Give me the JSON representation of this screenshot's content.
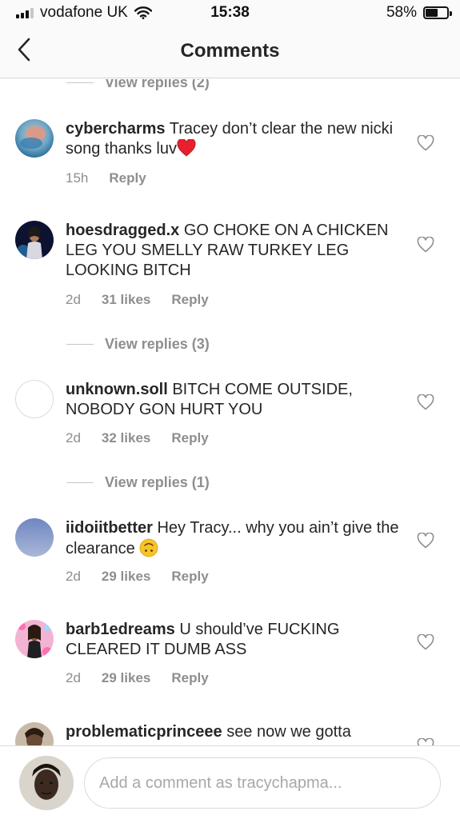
{
  "status_bar": {
    "carrier": "vodafone UK",
    "time": "15:38",
    "battery": "58%",
    "battery_level": 0.58
  },
  "header": {
    "title": "Comments",
    "back_icon": "chevron-left-icon"
  },
  "thread_top": {
    "view_replies": "View replies (2)"
  },
  "comments": [
    {
      "username": "cybercharms",
      "text": "Tracey don’t clear the new nicki song thanks luv",
      "emoji": "red-heart-emoji",
      "time": "15h",
      "likes": "",
      "reply": "Reply",
      "view_replies": ""
    },
    {
      "username": "hoesdragged.x",
      "text": "GO CHOKE ON A CHICKEN LEG YOU SMELLY RAW TURKEY LEG LOOKING BITCH",
      "time": "2d",
      "likes": "31 likes",
      "reply": "Reply",
      "view_replies": "View replies (3)"
    },
    {
      "username": "unknown.soll",
      "text": "BITCH COME OUTSIDE, NOBODY GON HURT YOU",
      "time": "2d",
      "likes": "32 likes",
      "reply": "Reply",
      "view_replies": "View replies (1)"
    },
    {
      "username": "iidoiitbetter",
      "text": "Hey Tracy... why you ain’t give the clearance",
      "emoji": "upside-down-face-emoji",
      "time": "2d",
      "likes": "29 likes",
      "reply": "Reply",
      "view_replies": ""
    },
    {
      "username": "barb1edreams",
      "text": "U should’ve FUCKING CLEARED IT DUMB ASS",
      "time": "2d",
      "likes": "29 likes",
      "reply": "Reply",
      "view_replies": ""
    },
    {
      "username": "problematicprinceee",
      "text": "see now we gotta",
      "time": "",
      "likes": "",
      "reply": "",
      "view_replies": ""
    }
  ],
  "composer": {
    "placeholder": "Add a comment as tracychapma..."
  },
  "colors": {
    "text": "#262626",
    "secondary": "#8e8e8e",
    "divider": "#dbdbdb",
    "bar_bg": "#fafafa",
    "heart_red": "#e8202e",
    "emoji_yellow": "#f7c325"
  }
}
